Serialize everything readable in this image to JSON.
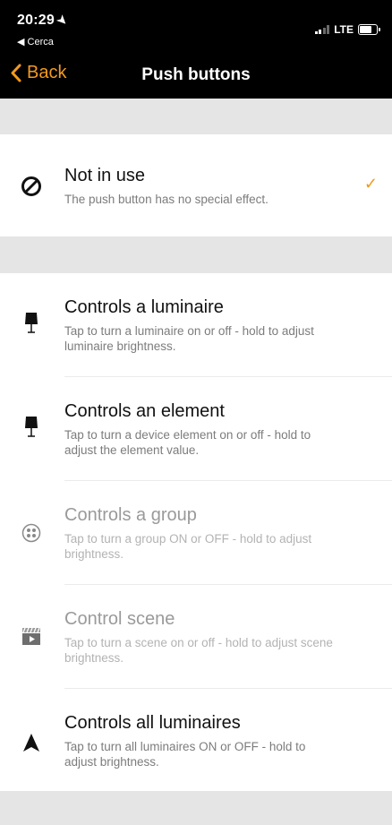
{
  "status_bar": {
    "time": "20:29",
    "location_icon": "location-arrow-icon",
    "carrier": "◀ Cerca",
    "network": "LTE"
  },
  "nav": {
    "back_label": "Back",
    "title": "Push buttons"
  },
  "colors": {
    "accent": "#F39A1E",
    "header_bg": "#000000",
    "band_bg": "#e5e5e5"
  },
  "options": [
    {
      "title": "Not in use",
      "description": "The push button has no special effect.",
      "icon": "prohibited-icon",
      "selected": true,
      "enabled": true
    },
    {
      "title": "Controls a luminaire",
      "description": "Tap to turn a luminaire on or off - hold to adjust luminaire brightness.",
      "icon": "lamp-icon",
      "selected": false,
      "enabled": true
    },
    {
      "title": "Controls an element",
      "description": "Tap to turn a device element on or off - hold to adjust the element value.",
      "icon": "lamp-icon",
      "selected": false,
      "enabled": true
    },
    {
      "title": "Controls a group",
      "description": "Tap to turn a group ON or OFF - hold to adjust brightness.",
      "icon": "group-icon",
      "selected": false,
      "enabled": false
    },
    {
      "title": "Control scene",
      "description": "Tap to turn a scene on or off - hold to adjust scene brightness.",
      "icon": "clapperboard-icon",
      "selected": false,
      "enabled": false
    },
    {
      "title": "Controls all luminaires",
      "description": "Tap to turn all luminaires ON or OFF - hold to adjust brightness.",
      "icon": "navigation-arrow-icon",
      "selected": false,
      "enabled": true
    }
  ]
}
